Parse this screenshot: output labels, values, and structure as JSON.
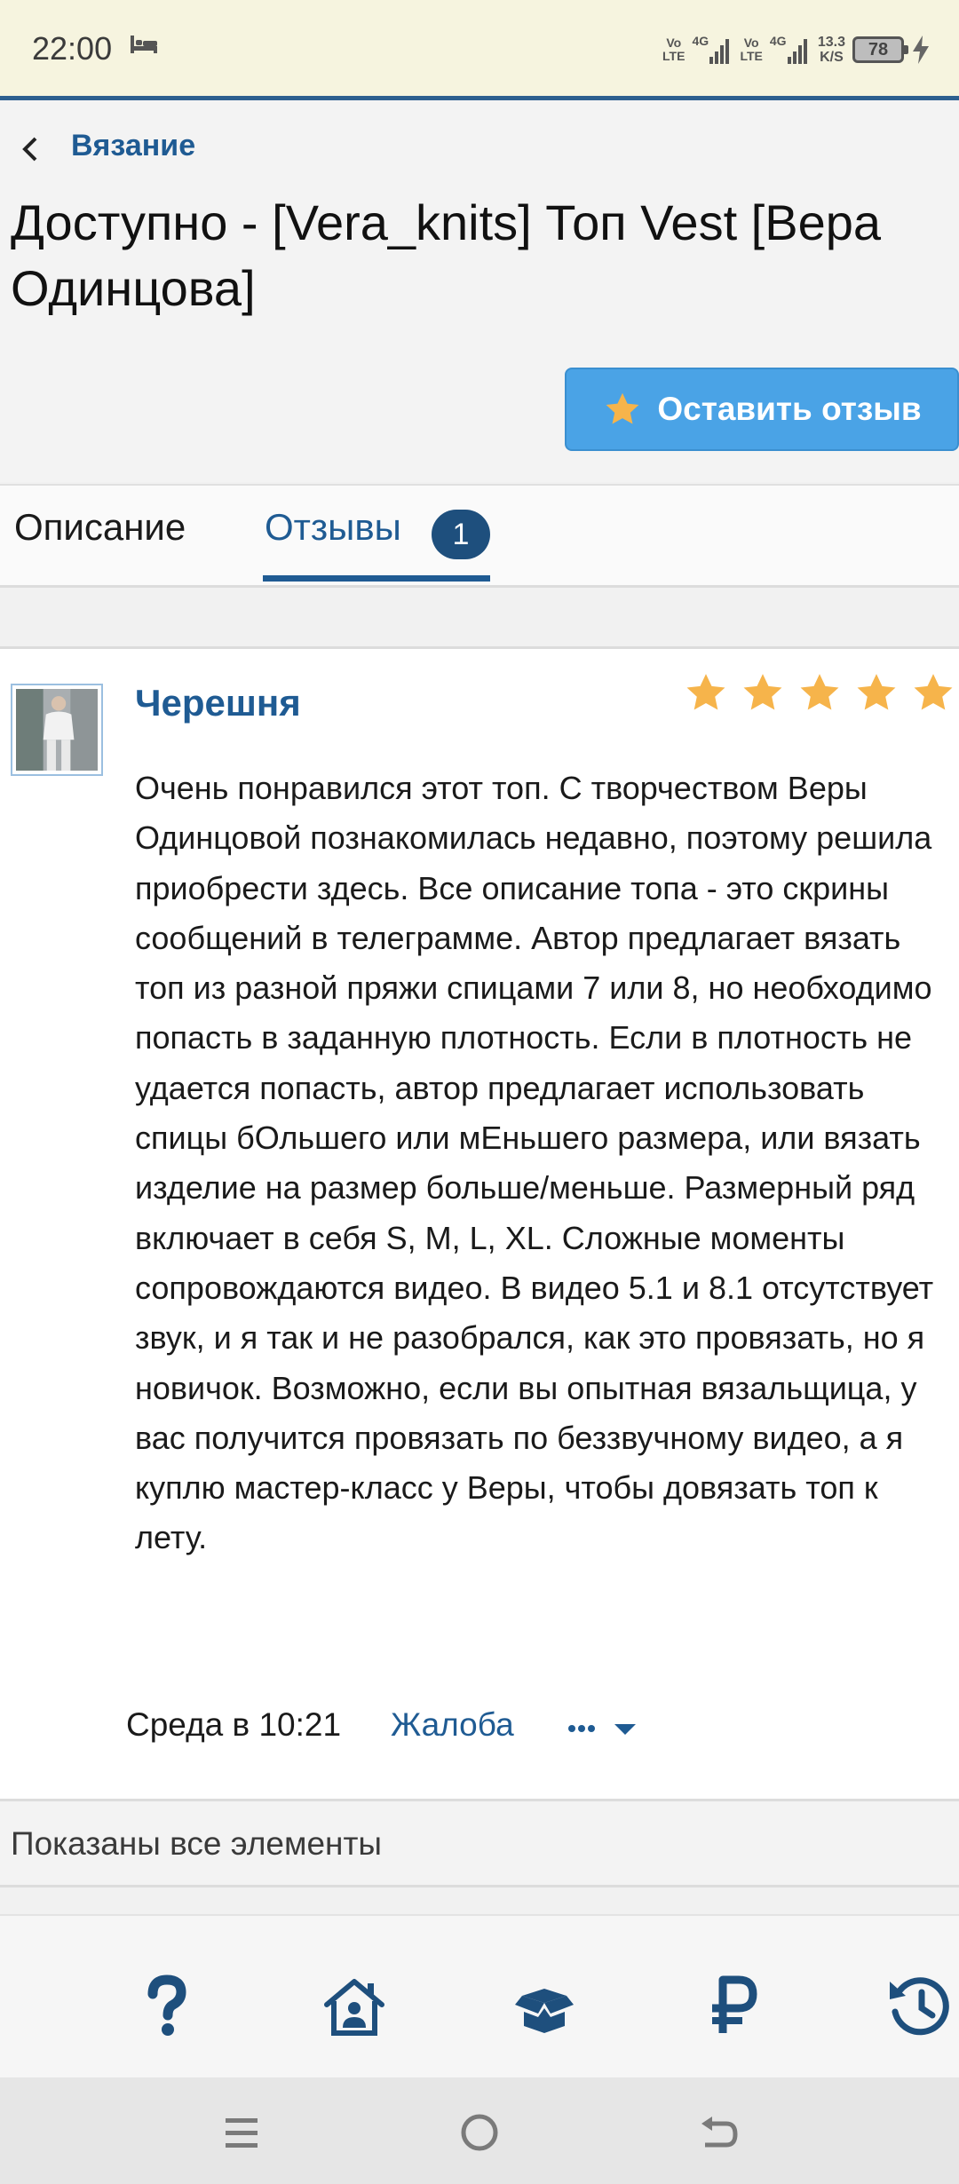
{
  "status_bar": {
    "time": "22:00",
    "net1_top": "Vo",
    "net1_bottom": "LTE",
    "net1_gen": "4G",
    "net2_top": "Vo",
    "net2_bottom": "LTE",
    "net2_gen": "4G",
    "speed_value": "13.3",
    "speed_unit": "K/S",
    "battery": "78"
  },
  "header": {
    "breadcrumb": "Вязание",
    "title": "Доступно - [Vera_knits] Топ Vest [Вера Одинцова]",
    "review_button_label": "Оставить отзыв"
  },
  "tabs": [
    {
      "label": "Описание"
    },
    {
      "label": "Отзывы",
      "count": "1"
    }
  ],
  "review": {
    "author": "Черешня",
    "rating": 5,
    "text": "Очень понравился этот топ. С творчеством Веры Одинцовой познакомилась недавно, поэтому решила приобрести здесь. Все описание топа - это скрины сообщений в телеграмме. Автор предлагает вязать топ из разной пряжи спицами 7 или 8, но необходимо попасть в заданную плотность. Если в плотность не удается попасть, автор предлагает использовать спицы бОльшего или мЕньшего размера, или вязать изделие на размер больше/меньше. Размерный ряд включает в себя S, M, L, XL. Сложные моменты сопровождаются видео. В видео 5.1 и 8.1 отсутствует звук, и я так и не разобрался, как это провязать, но я новичок. Возможно, если вы опытная вязальщица, у вас получится провязать по беззвучному видео, а я куплю мастер-класс у Веры, чтобы довязать топ к лету.",
    "date": "Среда в 10:21",
    "report_label": "Жалоба"
  },
  "footer": {
    "show_all": "Показаны все элементы"
  },
  "bottom_nav": {
    "icons": [
      "help-icon",
      "home-icon",
      "box-icon",
      "ruble-icon",
      "history-icon"
    ]
  },
  "colors": {
    "accent": "#1f5b93",
    "button": "#4aa3e6",
    "star": "#f6b44b",
    "status_bar_bg": "#f6f4df"
  }
}
